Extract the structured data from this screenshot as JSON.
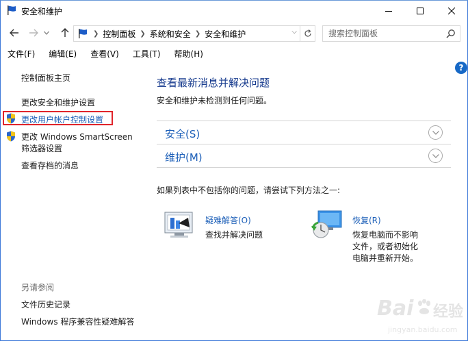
{
  "window": {
    "title": "安全和维护"
  },
  "nav": {
    "breadcrumbs": [
      "控制面板",
      "系统和安全",
      "安全和维护"
    ],
    "search_placeholder": "搜索控制面板"
  },
  "menu": [
    "文件(F)",
    "编辑(E)",
    "查看(V)",
    "工具(T)",
    "帮助(H)"
  ],
  "help_label": "?",
  "sidebar": {
    "home": "控制面板主页",
    "change_security": "更改安全和维护设置",
    "uac_settings": "更改用户帐户控制设置",
    "smartscreen_line1": "更改 Windows SmartScreen",
    "smartscreen_line2": "筛选器设置",
    "archived": "查看存档的消息",
    "see_also": "另请参阅",
    "file_history": "文件历史记录",
    "compat": "Windows 程序兼容性疑难解答"
  },
  "main": {
    "title": "查看最新消息并解决问题",
    "subtitle": "安全和维护未检测到任何问题。",
    "sections": [
      {
        "label": "安全(S)"
      },
      {
        "label": "维护(M)"
      }
    ],
    "hint": "如果列表中不包括你的问题，请尝试下列方法之一:",
    "troubleshoot": {
      "title": "疑难解答(O)",
      "desc": "查找并解决问题"
    },
    "recovery": {
      "title": "恢复(R)",
      "desc_lines": [
        "恢复电脑而不影响",
        "文件，或者初始化",
        "电脑并重新开始。"
      ]
    }
  },
  "watermark": {
    "logo_text": "Bai",
    "logo_cn": "经验",
    "url": "jingyan.baidu.com"
  },
  "colors": {
    "link_blue": "#1c5fb8",
    "title_blue": "#173b8e",
    "highlight_red": "#e0242a",
    "help_blue": "#1668c6"
  }
}
